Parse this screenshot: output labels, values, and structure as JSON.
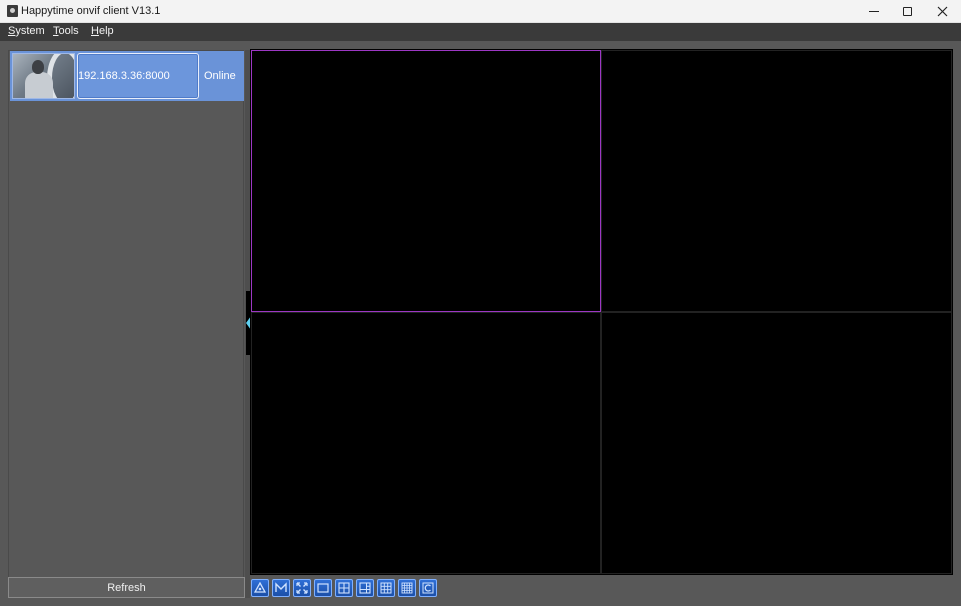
{
  "window": {
    "title": "Happytime onvif client V13.1"
  },
  "menu": {
    "items": [
      {
        "mnemonic": "S",
        "rest": "ystem"
      },
      {
        "mnemonic": "T",
        "rest": "ools"
      },
      {
        "mnemonic": "H",
        "rest": "elp"
      }
    ]
  },
  "device_list": {
    "devices": [
      {
        "address": "192.168.3.36:8000",
        "status": "Online"
      }
    ],
    "refresh_label": "Refresh"
  },
  "video_grid": {
    "layout": "2x2",
    "active_pane": 1
  },
  "toolbar": {
    "buttons": [
      "ptz-icon",
      "record-icon",
      "fullscreen-icon",
      "layout-1-icon",
      "layout-4-icon",
      "layout-6-icon",
      "layout-9-icon",
      "layout-16-icon",
      "custom-layout-icon"
    ]
  },
  "colors": {
    "selection": "#6a93d8",
    "active_pane_border": "#9c37c4",
    "toolbar_button": "#2f6fd6"
  }
}
